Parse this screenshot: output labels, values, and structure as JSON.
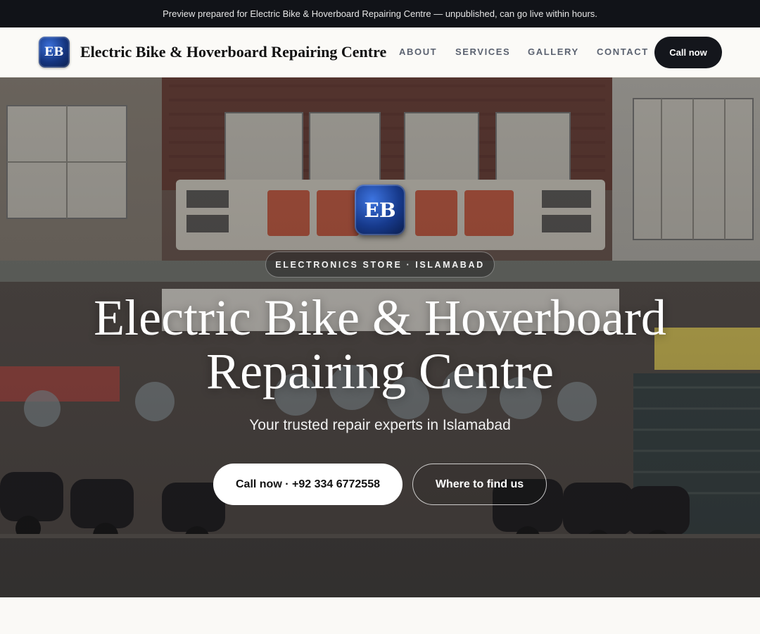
{
  "banner": {
    "text": "Preview prepared for Electric Bike & Hoverboard Repairing Centre — unpublished, can go live within hours."
  },
  "header": {
    "logo_text": "EB",
    "brand_name": "Electric Bike & Hoverboard Repairing Centre",
    "nav": [
      "ABOUT",
      "SERVICES",
      "GALLERY",
      "CONTACT"
    ],
    "cta_label": "Call now"
  },
  "hero": {
    "badge_text": "EB",
    "eyebrow": "ELECTRONICS STORE · ISLAMABAD",
    "title_line1": "Electric Bike & Hoverboard",
    "title_line2": "Repairing Centre",
    "subtitle": "Your trusted repair experts in Islamabad",
    "primary_button": "Call now · +92 334 6772558",
    "secondary_button": "Where to find us"
  },
  "colors": {
    "banner_bg": "#111318",
    "header_bg": "#fbfaf7",
    "brand_blue": "#173a8c",
    "dark_button": "#14161c"
  }
}
